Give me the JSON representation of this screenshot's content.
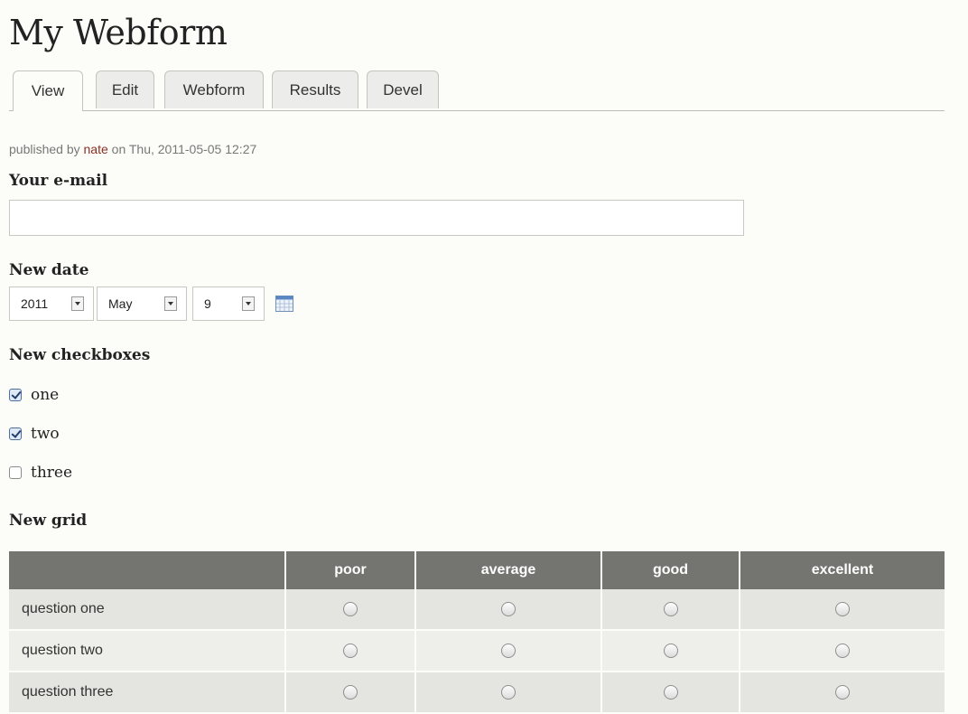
{
  "page": {
    "title": "My Webform"
  },
  "tabs": [
    {
      "label": "View",
      "active": true
    },
    {
      "label": "Edit",
      "active": false
    },
    {
      "label": "Webform",
      "active": false
    },
    {
      "label": "Results",
      "active": false
    },
    {
      "label": "Devel",
      "active": false
    }
  ],
  "meta": {
    "prefix": "published by",
    "author": "nate",
    "date_text": "on Thu, 2011-05-05 12:27"
  },
  "email": {
    "label": "Your e-mail",
    "value": ""
  },
  "date": {
    "label": "New date",
    "year": "2011",
    "month": "May",
    "day": "9",
    "calendar_icon": "calendar-icon"
  },
  "checkboxes": {
    "label": "New checkboxes",
    "items": [
      {
        "label": "one",
        "checked": true
      },
      {
        "label": "two",
        "checked": true
      },
      {
        "label": "three",
        "checked": false
      }
    ]
  },
  "grid": {
    "label": "New grid",
    "columns": [
      "",
      "poor",
      "average",
      "good",
      "excellent"
    ],
    "rows": [
      {
        "question": "question one"
      },
      {
        "question": "question two"
      },
      {
        "question": "question three"
      }
    ]
  },
  "colors": {
    "background": "#fcfcf8",
    "header": "#747470",
    "author_link": "#8b2f24"
  }
}
